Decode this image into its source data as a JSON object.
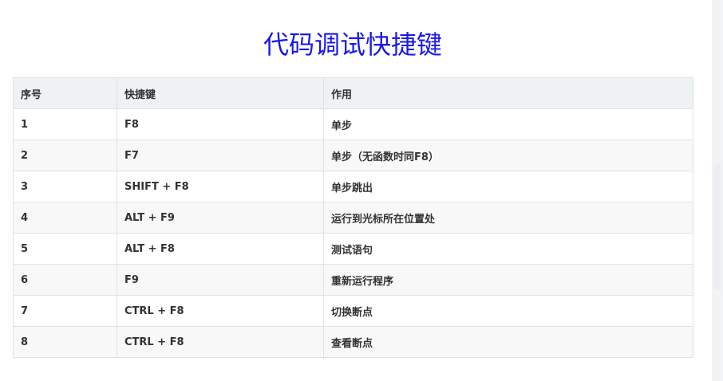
{
  "title": "代码调试快捷键",
  "table": {
    "headers": [
      "序号",
      "快捷键",
      "作用"
    ],
    "rows": [
      [
        "1",
        "F8",
        "单步"
      ],
      [
        "2",
        "F7",
        "单步（无函数时同F8）"
      ],
      [
        "3",
        "SHIFT + F8",
        "单步跳出"
      ],
      [
        "4",
        "ALT + F9",
        "运行到光标所在位置处"
      ],
      [
        "5",
        "ALT + F8",
        "测试语句"
      ],
      [
        "6",
        "F9",
        "重新运行程序"
      ],
      [
        "7",
        "CTRL + F8",
        "切换断点"
      ],
      [
        "8",
        "CTRL + F8",
        "查看断点"
      ]
    ]
  }
}
